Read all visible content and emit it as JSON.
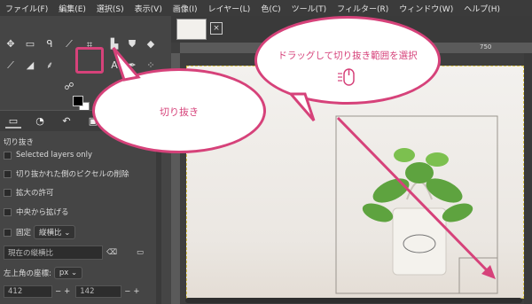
{
  "menubar": {
    "items": [
      "ファイル(F)",
      "編集(E)",
      "選択(S)",
      "表示(V)",
      "画像(I)",
      "レイヤー(L)",
      "色(C)",
      "ツール(T)",
      "フィルター(R)",
      "ウィンドウ(W)",
      "ヘルプ(H)"
    ]
  },
  "toolbox": {
    "tools": [
      "move-icon",
      "rect-select-icon",
      "lasso-icon",
      "fuzzy-select-icon",
      "crop-icon",
      "transform-icon",
      "bucket-icon",
      "paintbrush-icon",
      "eraser-icon",
      "smudge-icon",
      "clone-icon",
      "path-icon",
      "text-icon",
      "gradient-icon"
    ]
  },
  "options": {
    "title": "切り抜き",
    "selected_layers": "Selected layers only",
    "delete_pixels": "切り抜かれた側のピクセルの削除",
    "allow_growing": "拡大の許可",
    "expand_center": "中央から拡げる",
    "fixed": "固定",
    "fixed_mode": "縦横比",
    "current_ratio_placeholder": "現在の縦横比",
    "position_label": "左上角の座標:",
    "unit": "px",
    "x_value": "412",
    "y_value": "142"
  },
  "ruler": {
    "mark": "750"
  },
  "callouts": {
    "crop": "切り抜き",
    "drag": "ドラッグして切り抜き範囲を選択"
  },
  "colors": {
    "accent": "#d6427a"
  }
}
